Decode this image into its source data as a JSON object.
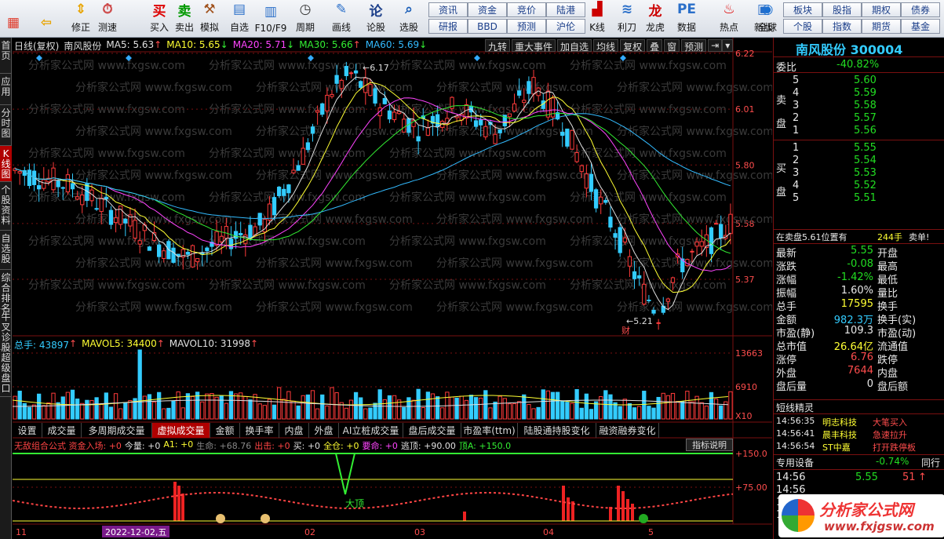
{
  "toolbar": {
    "buttons": [
      {
        "label": "",
        "icon": "grid-icon"
      },
      {
        "label": "",
        "icon": "back-arrow-icon"
      },
      {
        "label": "修正",
        "icon": "up-down-arrow-icon"
      },
      {
        "label": "测速",
        "icon": "speed-icon"
      },
      {
        "label": "买入",
        "icon": "buy-icon"
      },
      {
        "label": "卖出",
        "icon": "sell-icon"
      },
      {
        "label": "模拟",
        "icon": "hammer-icon"
      },
      {
        "label": "自选",
        "icon": "folder-icon"
      },
      {
        "label": "F10/F9",
        "icon": "f10-icon"
      },
      {
        "label": "周期",
        "icon": "period-icon"
      },
      {
        "label": "画线",
        "icon": "pencil-icon"
      },
      {
        "label": "论股",
        "icon": "discuss-icon"
      },
      {
        "label": "选股",
        "icon": "magnifier-icon"
      },
      {
        "label": "K线",
        "icon": "kline-icon"
      },
      {
        "label": "利刀",
        "icon": "knife-icon"
      },
      {
        "label": "龙虎",
        "icon": "dragon-icon"
      },
      {
        "label": "数据",
        "icon": "pe-icon"
      },
      {
        "label": "热点",
        "icon": "hot-icon"
      },
      {
        "label": "新版",
        "icon": "new-version-icon"
      },
      {
        "label": "全球",
        "icon": "globe-icon"
      }
    ],
    "mini_buttons": [
      [
        "资讯",
        "资金",
        "竞价",
        "陆港"
      ],
      [
        "研报",
        "BBD",
        "预测",
        "沪伦"
      ],
      [
        "板块",
        "股指",
        "期权",
        "债券"
      ],
      [
        "个股",
        "指数",
        "期货",
        "基金"
      ]
    ]
  },
  "sidebar": {
    "tabs": [
      "首页",
      "应用",
      "分时图",
      "K线图",
      "个股资料",
      "自选股",
      "综合排名",
      "牛叉诊股",
      "超级盘口"
    ],
    "active": "K线图"
  },
  "header": {
    "period": "日线(复权)",
    "stock_name": "南风股份",
    "ma": [
      {
        "label": "MA5: 5.63",
        "arrow": "↑",
        "color": "#e0e0e0"
      },
      {
        "label": "MA10: 5.65",
        "arrow": "↓",
        "color": "#ffff33"
      },
      {
        "label": "MA20: 5.71",
        "arrow": "↓",
        "color": "#ff44ff"
      },
      {
        "label": "MA30: 5.66",
        "arrow": "↑",
        "color": "#33ee33"
      },
      {
        "label": "MA60: 5.69",
        "arrow": "↓",
        "color": "#33bbff"
      }
    ],
    "tools": [
      "九转",
      "重大事件",
      "加自选",
      "均线",
      "复权",
      "叠",
      "窗",
      "预测"
    ]
  },
  "price_axis": [
    "6.22",
    "6.01",
    "5.80",
    "5.58",
    "5.37"
  ],
  "price_markers": {
    "high": "6.17",
    "low": "5.21",
    "low_tag": "财"
  },
  "watermark": "分析家公式网 www.fxgsw.com",
  "volume": {
    "labels": [
      {
        "text": "总手: 43897",
        "arrow": "↑",
        "color": "#33ccff"
      },
      {
        "text": "MAVOL5: 34400",
        "arrow": "↑",
        "color": "#ffff33"
      },
      {
        "text": "MAVOL10: 31998",
        "arrow": "↑",
        "color": "#e0e0e0"
      }
    ],
    "axis": [
      "13663",
      "6910"
    ],
    "unit": "X10"
  },
  "bottom_tabs": [
    "设置",
    "成交量",
    "多周期成交量",
    "虚拟成交量",
    "金额",
    "换手率",
    "内盘",
    "外盘",
    "AI立桩成交量",
    "盘后成交量",
    "市盈率(ttm)",
    "陆股通持股变化",
    "融资融券变化"
  ],
  "bottom_tabs_active": "虚拟成交量",
  "indicator": {
    "items": [
      {
        "text": "无敌组合公式 资金入场: +0",
        "color": "#ff4444"
      },
      {
        "text": "今量: +0",
        "color": "#e0e0e0"
      },
      {
        "text": "A1: +0",
        "color": "#ffff33"
      },
      {
        "text": "生命: +68.76",
        "color": "#888888"
      },
      {
        "text": "出击: +0",
        "color": "#ff4444"
      },
      {
        "text": "买: +0",
        "color": "#e0e0e0"
      },
      {
        "text": "全仓: +0",
        "color": "#ffff33"
      },
      {
        "text": "要命: +0",
        "color": "#ff44ff"
      },
      {
        "text": "逃顶: +90.00",
        "color": "#e0e0e0"
      },
      {
        "text": "顶A: +150.0",
        "color": "#33ee33"
      }
    ],
    "help": "指标说明",
    "axis": [
      "+150.0",
      "+75.00"
    ],
    "top_label": "大顶"
  },
  "date_axis": [
    "11",
    "2022-12-02,五",
    "02",
    "03",
    "04",
    "5"
  ],
  "quote": {
    "title": "南风股份 300004",
    "weibi_label": "委比",
    "weibi_value": "-40.82%",
    "sell_label": "卖盘",
    "buy_label": "买盘",
    "sells": [
      {
        "level": "5",
        "price": "5.60",
        "vol": ""
      },
      {
        "level": "4",
        "price": "5.59",
        "vol": ""
      },
      {
        "level": "3",
        "price": "5.58",
        "vol": ""
      },
      {
        "level": "2",
        "price": "5.57",
        "vol": ""
      },
      {
        "level": "1",
        "price": "5.56",
        "vol": ""
      }
    ],
    "buys": [
      {
        "level": "1",
        "price": "5.55",
        "vol": ""
      },
      {
        "level": "2",
        "price": "5.54",
        "vol": ""
      },
      {
        "level": "3",
        "price": "5.53",
        "vol": ""
      },
      {
        "level": "4",
        "price": "5.52",
        "vol": ""
      },
      {
        "level": "5",
        "price": "5.51",
        "vol": ""
      }
    ],
    "notice": {
      "text": "在卖盘5.61位置有",
      "vol": "244手",
      "tag": "卖单!"
    },
    "stats": [
      {
        "l": "最新",
        "v": "5.55",
        "vc": "#22dd22",
        "r": "开盘",
        "rv": ""
      },
      {
        "l": "涨跌",
        "v": "-0.08",
        "vc": "#22dd22",
        "r": "最高",
        "rv": ""
      },
      {
        "l": "涨幅",
        "v": "-1.42%",
        "vc": "#22dd22",
        "r": "最低",
        "rv": ""
      },
      {
        "l": "振幅",
        "v": "1.60%",
        "vc": "#e8e8e8",
        "r": "量比",
        "rv": ""
      },
      {
        "l": "总手",
        "v": "17595",
        "vc": "#ffff33",
        "r": "换手",
        "rv": ""
      },
      {
        "l": "金额",
        "v": "982.3万",
        "vc": "#33ccff",
        "r": "换手(实)",
        "rv": ""
      },
      {
        "l": "市盈(静)",
        "v": "109.3",
        "vc": "#e8e8e8",
        "r": "市盈(动)",
        "rv": ""
      },
      {
        "l": "总市值",
        "v": "26.64亿",
        "vc": "#ffff33",
        "r": "流通值",
        "rv": ""
      },
      {
        "l": "涨停",
        "v": "6.76",
        "vc": "#ff4d4d",
        "r": "跌停",
        "rv": ""
      },
      {
        "l": "外盘",
        "v": "7644",
        "vc": "#ff4d4d",
        "r": "内盘",
        "rv": ""
      },
      {
        "l": "盘后量",
        "v": "0",
        "vc": "#e8e8e8",
        "r": "盘后额",
        "rv": ""
      }
    ],
    "elves_title": "短线精灵",
    "elves": [
      {
        "time": "14:56:35",
        "name": "明志科技",
        "event": "大笔买入",
        "color": "#ff4d4d"
      },
      {
        "time": "14:56:41",
        "name": "晨丰科技",
        "event": "急速拉升",
        "color": "#ff4d4d"
      },
      {
        "time": "14:56:54",
        "name": "ST中嘉",
        "event": "打开跌停板",
        "color": "#ff4d4d"
      }
    ],
    "device_label": "专用设备",
    "device_pct": "-0.74%",
    "device_extra": "同行",
    "ticks": [
      {
        "time": "14:56",
        "price": "5.55",
        "vol": "51",
        "dir": "↑"
      },
      {
        "time": "14:56",
        "price": "",
        "vol": "",
        "dir": ""
      },
      {
        "time": "14:56",
        "price": "",
        "vol": "",
        "dir": ""
      },
      {
        "time": "14:",
        "price": "",
        "vol": "",
        "dir": ""
      }
    ],
    "logo_text": "分析家公式网",
    "logo_url": "www.fxjgsw.com"
  },
  "colors": {
    "up": "#ff3b3b",
    "down": "#33ccff",
    "grid": "#7a1010"
  }
}
